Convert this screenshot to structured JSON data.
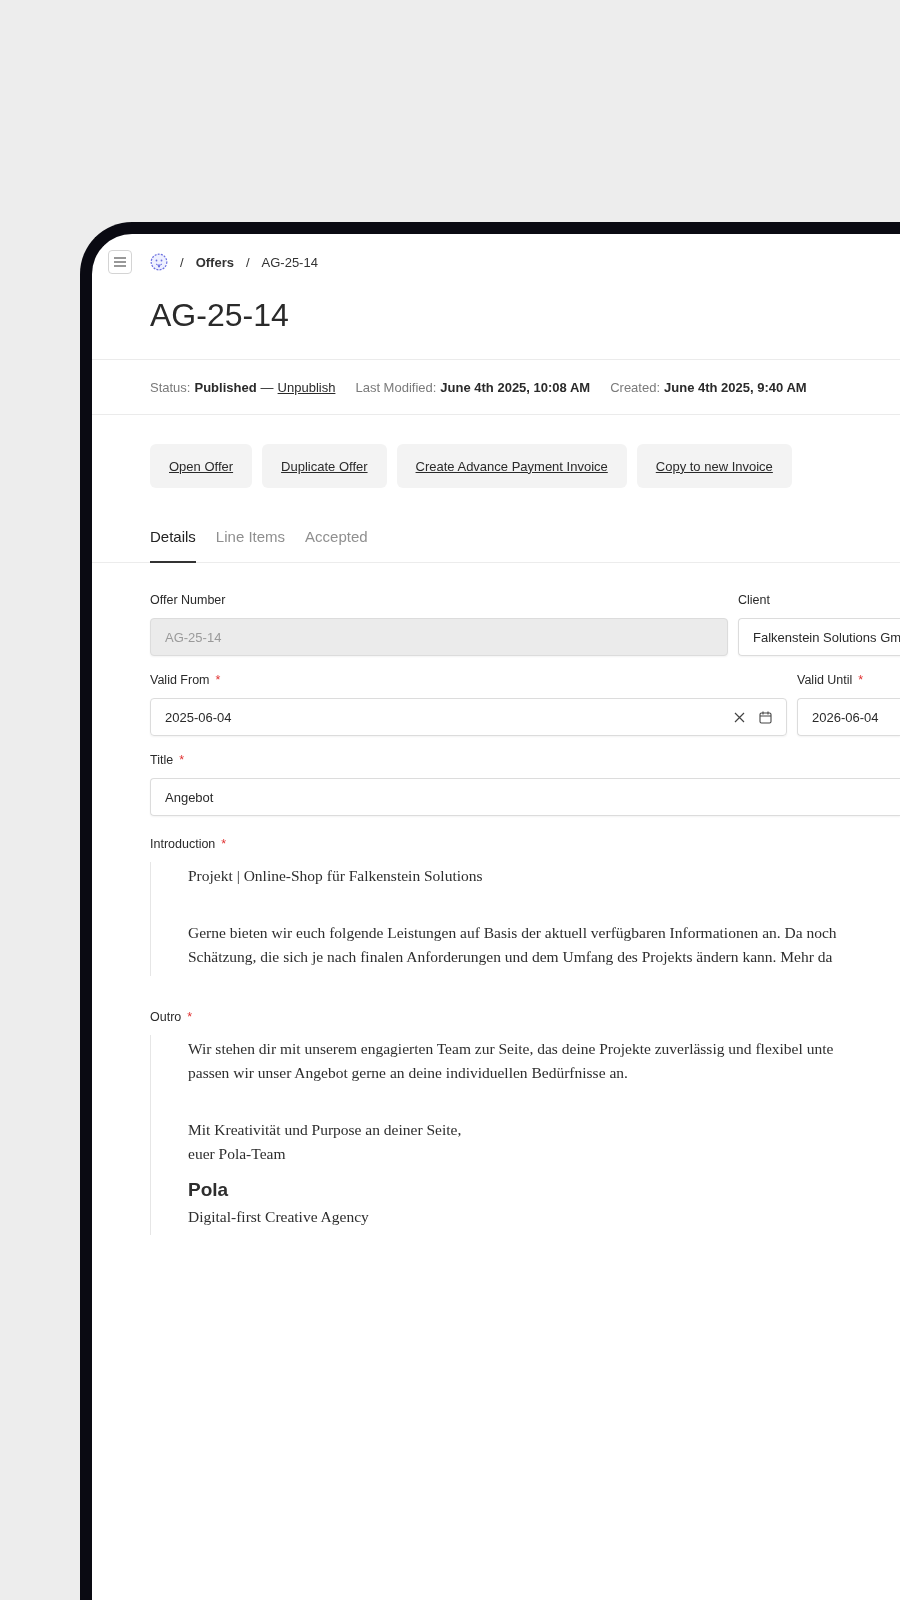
{
  "breadcrumb": {
    "separator": "/",
    "items": [
      {
        "label": "Offers",
        "bold": true
      },
      {
        "label": "AG-25-14",
        "bold": false
      }
    ]
  },
  "title": "AG-25-14",
  "required_mark": "*",
  "meta": {
    "status_label": "Status:",
    "status_value": "Published",
    "dash": "—",
    "status_action": "Unpublish",
    "entries": [
      {
        "label": "Last Modified:",
        "value": "June 4th 2025, 10:08 AM"
      },
      {
        "label": "Created:",
        "value": "June 4th 2025, 9:40 AM"
      }
    ]
  },
  "actions": [
    "Open Offer",
    "Duplicate Offer",
    "Create Advance Payment Invoice",
    "Copy to new Invoice"
  ],
  "tabs": [
    {
      "label": "Details",
      "selected": true
    },
    {
      "label": "Line Items",
      "selected": false
    },
    {
      "label": "Accepted",
      "selected": false
    }
  ],
  "field_rows": [
    [
      {
        "label": "Offer Number",
        "required": false,
        "disabled": true,
        "kind": "text",
        "value": "AG-25-14"
      },
      {
        "label": "Client",
        "required": false,
        "disabled": false,
        "kind": "text",
        "value": "Falkenstein Solutions Gm"
      }
    ],
    [
      {
        "label": "Valid From",
        "required": true,
        "disabled": false,
        "kind": "date",
        "value": "2025-06-04"
      },
      {
        "label": "Valid Until",
        "required": true,
        "disabled": false,
        "kind": "text",
        "value": "2026-06-04"
      }
    ],
    [
      {
        "label": "Title",
        "required": true,
        "disabled": false,
        "kind": "text",
        "value": "Angebot"
      }
    ]
  ],
  "editors": [
    {
      "label": "Introduction",
      "required": true,
      "blocks": [
        {
          "kind": "paragraph",
          "lines": [
            "Projekt | Online-Shop für Falkenstein Solutions"
          ]
        },
        {
          "kind": "empty"
        },
        {
          "kind": "paragraph",
          "lines": [
            "Gerne bieten wir euch folgende Leistungen auf Basis der aktuell verfügbaren Informationen an. Da noch",
            "Schätzung, die sich je nach finalen Anforderungen und dem Umfang des Projekts ändern kann. Mehr da"
          ]
        }
      ]
    },
    {
      "label": "Outro",
      "required": true,
      "blocks": [
        {
          "kind": "paragraph",
          "lines": [
            "Wir stehen dir mit unserem engagierten Team zur Seite, das deine Projekte zuverlässig und flexibel unte",
            "passen wir unser Angebot gerne an deine individuellen Bedürfnisse an."
          ]
        },
        {
          "kind": "empty"
        },
        {
          "kind": "paragraph",
          "lines": [
            "Mit Kreativität und Purpose an deiner Seite,",
            "euer Pola-Team"
          ]
        },
        {
          "kind": "heading",
          "lines": [
            "Pola"
          ]
        },
        {
          "kind": "paragraph",
          "lines": [
            "Digital-first Creative Agency"
          ]
        }
      ]
    }
  ]
}
